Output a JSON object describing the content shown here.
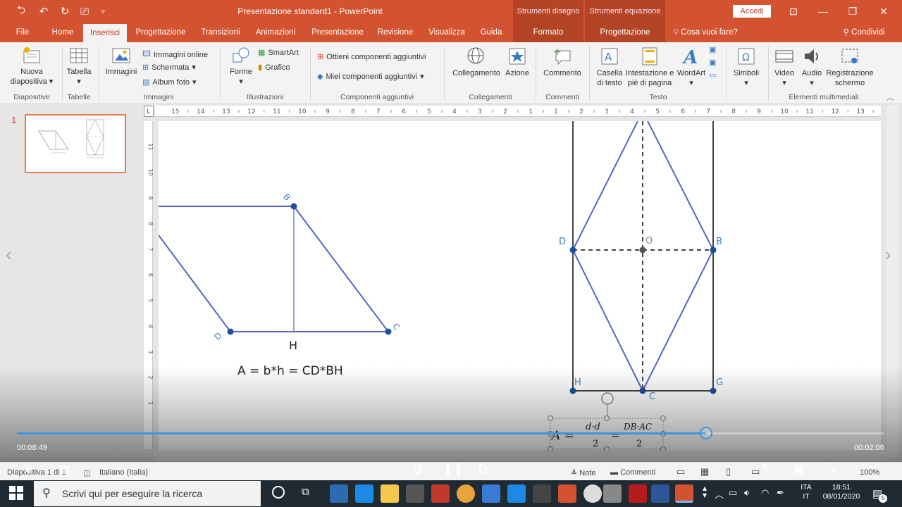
{
  "window": {
    "title": "Presentazione standard1  -  PowerPoint",
    "context_draw": "Strumenti disegno",
    "context_equation": "Strumenti equazione",
    "sign_in": "Accedi"
  },
  "tabs": [
    {
      "label": "File"
    },
    {
      "label": "Home"
    },
    {
      "label": "Inserisci"
    },
    {
      "label": "Progettazione"
    },
    {
      "label": "Transizioni"
    },
    {
      "label": "Animazioni"
    },
    {
      "label": "Presentazione"
    },
    {
      "label": "Revisione"
    },
    {
      "label": "Visualizza"
    },
    {
      "label": "Guida"
    },
    {
      "label": "Formato"
    },
    {
      "label": "Progettazione"
    }
  ],
  "tell_me": "Cosa vuoi fare?",
  "share": "Condividi",
  "ribbon": {
    "new_slide_1": "Nuova",
    "new_slide_2": "diapositiva",
    "table": "Tabella",
    "images": "Immagini",
    "online_images": "Immagini online",
    "screenshot": "Schermata",
    "photo_album": "Album foto",
    "shapes": "Forme",
    "smartart": "SmartArt",
    "chart": "Grafico",
    "get_addins": "Ottieni componenti aggiuntivi",
    "my_addins": "Miei componenti aggiuntivi",
    "link": "Collegamento",
    "action": "Azione",
    "comment": "Commento",
    "textbox_1": "Casella",
    "textbox_2": "di testo",
    "header_1": "Intestazione e",
    "header_2": "piè di pagina",
    "wordart": "WordArt",
    "symbols": "Simboli",
    "video": "Video",
    "audio": "Audio",
    "record_1": "Registrazione",
    "record_2": "schermo",
    "groups": {
      "slides": "Diapositive",
      "tables": "Tabelle",
      "images": "Immagini",
      "illustrations": "Illustrazioni",
      "addins": "Componenti aggiuntivi",
      "links": "Collegamenti",
      "comments": "Commenti",
      "text": "Testo",
      "media": "Elementi multimediali"
    }
  },
  "slide_panel": {
    "number": "1"
  },
  "ruler": {
    "corner": "L",
    "h_ticks": [
      "15",
      "14",
      "13",
      "12",
      "11",
      "10",
      "9",
      "8",
      "7",
      "6",
      "5",
      "4",
      "3",
      "2",
      "1",
      "1",
      "2",
      "3",
      "4",
      "5",
      "6",
      "7",
      "8",
      "9",
      "10",
      "11",
      "12",
      "13"
    ],
    "v_ticks": [
      "11",
      "10",
      "9",
      "8",
      "7",
      "6",
      "5",
      "4",
      "3",
      "2",
      "1"
    ]
  },
  "slide": {
    "left_figure": {
      "label_b": "B",
      "label_c": "C",
      "label_d": "D",
      "label_h": "H",
      "formula": "A = b*h = CD*BH"
    },
    "right_figure": {
      "label_d": "D",
      "label_o": "O",
      "label_b": "B",
      "label_h": "H",
      "label_c": "C",
      "label_g": "G"
    },
    "equation": {
      "lhs": "A =",
      "num1": "d·d",
      "den1": "2",
      "eq2": "=",
      "num2": "DB·AC",
      "den2": "2"
    }
  },
  "video": {
    "elapsed": "00:08:49",
    "remaining": "00:02:06",
    "progress": 0.795,
    "skip_back": "10",
    "skip_fwd": "30"
  },
  "status": {
    "slide_info": "Diapositiva 1 di 1",
    "language": "Italiano (Italia)",
    "notes": "Note",
    "comments": "Commenti",
    "zoom": "100%"
  },
  "taskbar": {
    "search": "Scrivi qui per eseguire la ricerca",
    "lang1": "ITA",
    "lang2": "IT",
    "time": "18:51",
    "date": "08/01/2020",
    "notif_count": "5"
  },
  "colors": {
    "accent": "#d35230",
    "context": "#b34426",
    "figure_line": "#5566c4",
    "point": "#1f4f9a",
    "label": "#3b7fc4",
    "seek": "#3a96dd"
  }
}
